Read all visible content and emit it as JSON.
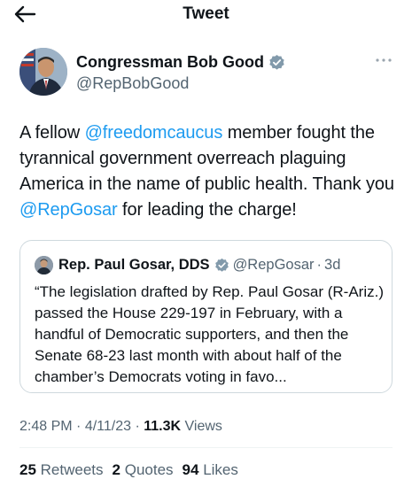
{
  "header": {
    "title": "Tweet"
  },
  "tweet": {
    "author_name": "Congressman Bob Good",
    "author_handle": "@RepBobGood",
    "text_1": "A fellow ",
    "mention_1": "@freedomcaucus",
    "text_2": " member fought the tyrannical government overreach plaguing America in the name of public health. Thank you ",
    "mention_2": "@RepGosar",
    "text_3": " for leading the charge!",
    "time": "2:48 PM",
    "date": "4/11/23",
    "views_count": "11.3K",
    "views_label": "Views",
    "retweets_count": "25",
    "retweets_label": "Retweets",
    "quotes_count": "2",
    "quotes_label": "Quotes",
    "likes_count": "94",
    "likes_label": "Likes"
  },
  "quoted": {
    "name": "Rep. Paul Gosar, DDS",
    "handle": "@RepGosar",
    "age": "3d",
    "text": "“The legislation drafted by Rep. Paul Gosar (R-Ariz.) passed the House 229-197 in February, with a handful of Democratic supporters, and then the Senate 68-23 last month with about half of the chamber’s Democrats voting in favo..."
  },
  "colors": {
    "accent": "#1d9bf0",
    "secondary": "#536471",
    "text": "#0f1419",
    "border": "#cfd9de"
  }
}
